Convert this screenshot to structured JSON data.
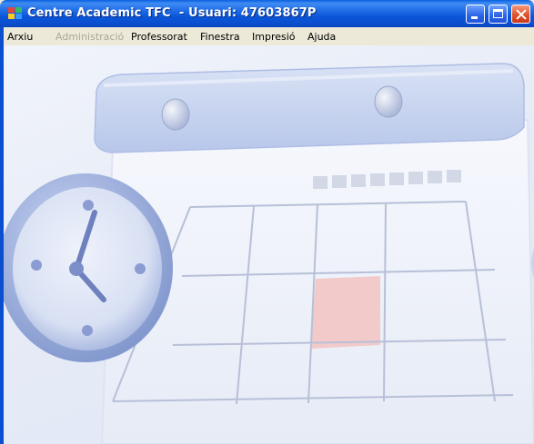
{
  "window": {
    "title": "Centre Academic TFC  - Usuari: 47603867P",
    "buttons": {
      "minimize": "minimize-icon",
      "maximize": "maximize-icon",
      "close": "close-icon"
    }
  },
  "menu": {
    "items": [
      {
        "label": "Arxiu",
        "enabled": true
      },
      {
        "label": "Administració",
        "enabled": false
      },
      {
        "label": "Professorat",
        "enabled": true
      },
      {
        "label": "Finestra",
        "enabled": true
      },
      {
        "label": "Impresió",
        "enabled": true
      },
      {
        "label": "Ajuda",
        "enabled": true
      }
    ]
  },
  "background": {
    "image": "calendar-and-clock-illustration",
    "colors": {
      "accent": "#8fa3d6",
      "highlight": "#f2c8c8"
    }
  }
}
